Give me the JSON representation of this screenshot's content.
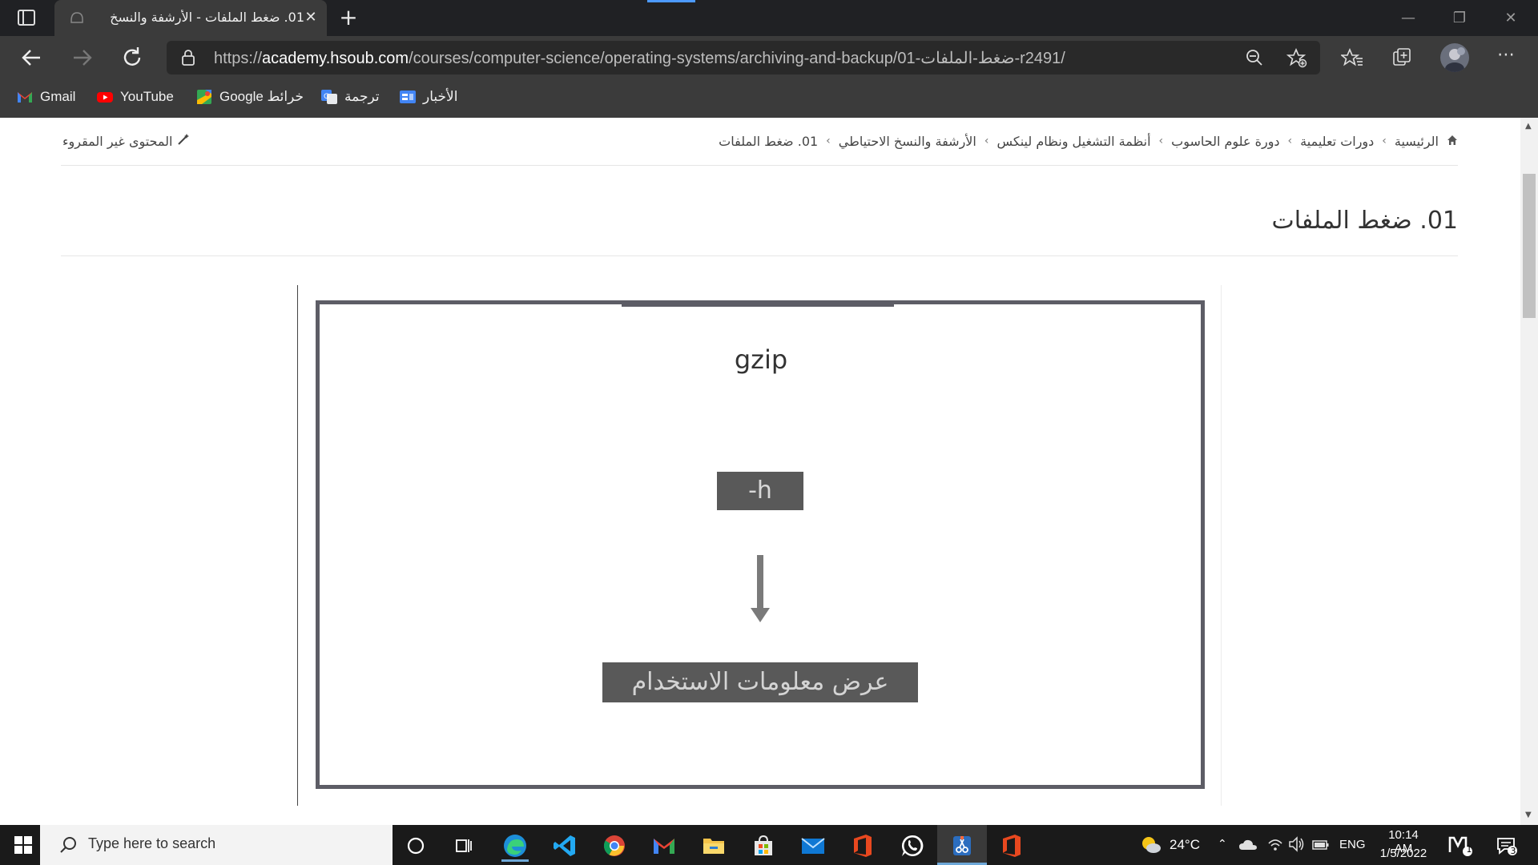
{
  "browser": {
    "tab_title": "01. ضغط الملفات - الأرشفة والنسخ",
    "tab_close": "✕",
    "new_tab": "+",
    "window_controls": {
      "minimize": "—",
      "restore": "❐",
      "close": "✕"
    },
    "url_prefix": "https://",
    "url_domain": "academy.hsoub.com",
    "url_path": "/courses/computer-science/operating-systems/archiving-and-backup/01-ضغط-الملفات-r2491/",
    "bookmarks": [
      {
        "label": "Gmail",
        "icon": "gmail-icon"
      },
      {
        "label": "YouTube",
        "icon": "youtube-icon"
      },
      {
        "label": "Google خرائط",
        "icon": "maps-icon"
      },
      {
        "label": "ترجمة",
        "icon": "translate-icon"
      },
      {
        "label": "الأخبار",
        "icon": "news-icon"
      }
    ]
  },
  "page": {
    "breadcrumb": [
      "الرئيسية",
      "دورات تعليمية",
      "دورة علوم الحاسوب",
      "أنظمة التشغيل ونظام لينكس",
      "الأرشفة والنسخ الاحتياطي",
      "01. ضغط الملفات"
    ],
    "breadcrumb_separator": "›",
    "unread_label": "المحتوى غير المقروء",
    "title": "01. ضغط الملفات",
    "figure": {
      "command": "gzip",
      "option": "-h",
      "description": "عرض معلومات الاستخدام"
    }
  },
  "taskbar": {
    "search_placeholder": "Type here to search",
    "weather": "24°C",
    "language": "ENG",
    "time": "10:14 AM",
    "date": "1/5/2022",
    "notification_count": "3",
    "badge_count": "1"
  },
  "colors": {
    "chrome_dark": "#202124",
    "chrome_mid": "#3b3b3b",
    "figure_border": "#5d5d66",
    "figure_box": "#595959"
  }
}
